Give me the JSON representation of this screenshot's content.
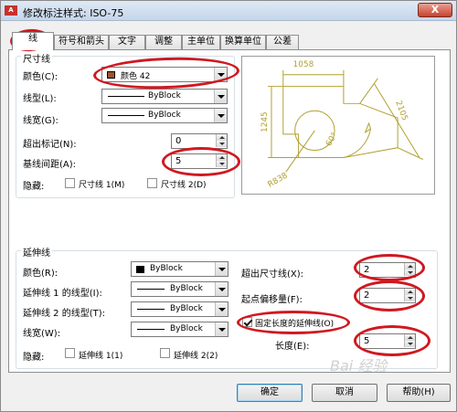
{
  "window": {
    "title": "修改标注样式: ISO-75",
    "close": "X",
    "app_icon": "A"
  },
  "tabs": [
    "线",
    "符号和箭头",
    "文字",
    "调整",
    "主单位",
    "换算单位",
    "公差"
  ],
  "dim_lines": {
    "group_title": "尺寸线",
    "color": {
      "label": "颜色(C):",
      "value": "颜色 42",
      "swatch": "#a0522d"
    },
    "linetype": {
      "label": "线型(L):",
      "value": "ByBlock"
    },
    "lineweight": {
      "label": "线宽(G):",
      "value": "ByBlock"
    },
    "extend": {
      "label": "超出标记(N):",
      "value": "0"
    },
    "baseline": {
      "label": "基线间距(A):",
      "value": "5"
    },
    "suppress": {
      "label": "隐藏:",
      "opt1": "尺寸线 1(M)",
      "opt2": "尺寸线 2(D)"
    }
  },
  "ext_lines": {
    "group_title": "延伸线",
    "color": {
      "label": "颜色(R):",
      "value": "ByBlock"
    },
    "linetype1": {
      "label": "延伸线 1 的线型(I):",
      "value": "ByBlock"
    },
    "linetype2": {
      "label": "延伸线 2 的线型(T):",
      "value": "ByBlock"
    },
    "lineweight": {
      "label": "线宽(W):",
      "value": "ByBlock"
    },
    "suppress": {
      "label": "隐藏:",
      "opt1": "延伸线 1(1)",
      "opt2": "延伸线 2(2)"
    },
    "extend": {
      "label": "超出尺寸线(X):",
      "value": "2"
    },
    "offset": {
      "label": "起点偏移量(F):",
      "value": "2"
    },
    "fixed": {
      "label": "固定长度的延伸线(O)",
      "checked": true
    },
    "length": {
      "label": "长度(E):",
      "value": "5"
    }
  },
  "preview": {
    "dims": [
      "1058",
      "1245",
      "2105",
      "60°",
      "R838"
    ],
    "color": "#b0a030"
  },
  "buttons": {
    "ok": "确定",
    "cancel": "取消",
    "help": "帮助(H)"
  },
  "watermark": "Bai 经验",
  "annotation_color": "#d01820"
}
